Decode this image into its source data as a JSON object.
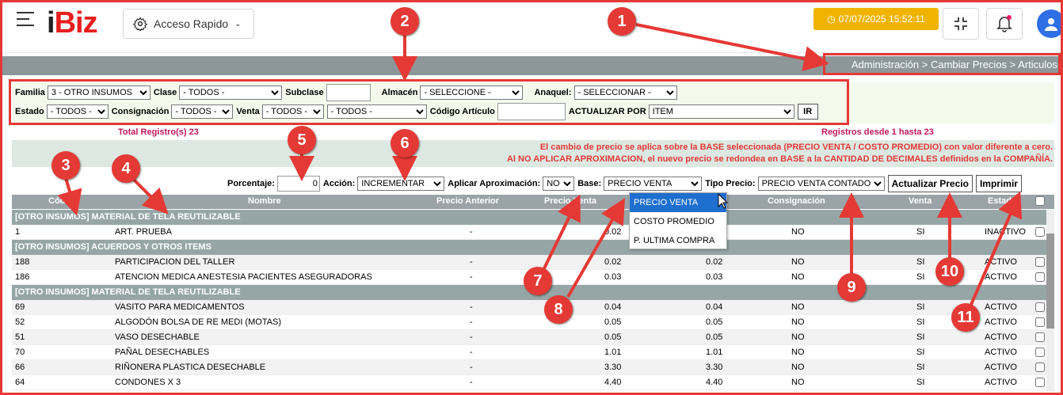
{
  "header": {
    "logo_i": "i",
    "logo_biz": "Biz",
    "quick_access": "Acceso Rapido",
    "datetime": "07/07/2025 15:52:11"
  },
  "breadcrumb": "Administración > Cambiar Precios > Articulos",
  "filters": {
    "familia_label": "Familia",
    "familia_value": "3 - OTRO INSUMOS",
    "clase_label": "Clase",
    "clase_value": "- TODOS -",
    "subclase_label": "Subclase",
    "subclase_value": "",
    "almacen_label": "Almacén",
    "almacen_value": "- SELECCIONE -",
    "anaquel_label": "Anaquel:",
    "anaquel_value": "- SELECCIONAR -",
    "estado_label": "Estado",
    "estado_value": "- TODOS -",
    "consignacion_label": "Consignación",
    "consignacion_value": "- TODOS -",
    "venta_label": "Venta",
    "venta_value": "- TODOS -",
    "venta_extra_value": "- TODOS -",
    "codigo_label": "Código Artículo",
    "codigo_value": "",
    "actualizar_label": "ACTUALIZAR POR",
    "actualizar_value": "ITEM",
    "ir_button": "IR"
  },
  "totals": {
    "total": "Total Registro(s) 23",
    "range": "Registros desde 1 hasta 23"
  },
  "notice": {
    "line1": "El cambio de precio se aplica sobre la BASE seleccionada (PRECIO VENTA / COSTO PROMEDIO) con valor diferente a cero.",
    "line2": "Al NO APLICAR APROXIMACION, el nuevo precio se redondea en BASE a la CANTIDAD DE DECIMALES definidos en la COMPAÑÍA."
  },
  "actions": {
    "porcentaje_label": "Porcentaje:",
    "porcentaje_value": "0",
    "accion_label": "Acción:",
    "accion_value": "INCREMENTAR",
    "aprox_label": "Aplicar Aproximación:",
    "aprox_value": "NO",
    "base_label": "Base:",
    "base_value": "PRECIO VENTA",
    "tipo_label": "Tipo Precio:",
    "tipo_value": "PRECIO VENTA CONTADO",
    "update_button": "Actualizar Precio",
    "print_button": "Imprimir"
  },
  "base_options": [
    "PRECIO VENTA",
    "COSTO PROMEDIO",
    "P. ULTIMA COMPRA"
  ],
  "table": {
    "headers": {
      "codigo": "Código",
      "nombre": "Nombre",
      "anterior": "Precio Anterior",
      "venta_precio": "Precio Venta",
      "consignacion": "Consignación",
      "venta": "Venta",
      "estado": "Estado"
    },
    "groups": [
      {
        "title": "[OTRO INSUMOS] MATERIAL DE TELA REUTILIZABLE",
        "rows": [
          {
            "code": "1",
            "name": "ART. PRUEBA",
            "prev": "-",
            "price": "0.02",
            "new": "",
            "cons": "NO",
            "venta": "SI",
            "estado": "INACTIVO"
          }
        ]
      },
      {
        "title": "[OTRO INSUMOS] ACUERDOS Y OTROS ITEMS",
        "rows": [
          {
            "code": "188",
            "name": "PARTICIPACION DEL TALLER",
            "prev": "-",
            "price": "0.02",
            "new": "0.02",
            "cons": "NO",
            "venta": "SI",
            "estado": "ACTIVO"
          },
          {
            "code": "186",
            "name": "ATENCION MEDICA ANESTESIA PACIENTES ASEGURADORAS",
            "prev": "-",
            "price": "0.03",
            "new": "0.03",
            "cons": "NO",
            "venta": "SI",
            "estado": "ACTIVO"
          }
        ]
      },
      {
        "title": "[OTRO INSUMOS] MATERIAL DE TELA REUTILIZABLE",
        "rows": [
          {
            "code": "69",
            "name": "VASITO PARA MEDICAMENTOS",
            "prev": "-",
            "price": "0.04",
            "new": "0.04",
            "cons": "NO",
            "venta": "SI",
            "estado": "ACTIVO"
          },
          {
            "code": "52",
            "name": "ALGODÓN BOLSA DE RE MEDI (MOTAS)",
            "prev": "-",
            "price": "0.05",
            "new": "0.05",
            "cons": "NO",
            "venta": "SI",
            "estado": "ACTIVO"
          },
          {
            "code": "51",
            "name": "VASO DESECHABLE",
            "prev": "-",
            "price": "0.05",
            "new": "0.05",
            "cons": "NO",
            "venta": "SI",
            "estado": "ACTIVO"
          },
          {
            "code": "70",
            "name": "PAÑAL DESECHABLES",
            "prev": "-",
            "price": "1.01",
            "new": "1.01",
            "cons": "NO",
            "venta": "SI",
            "estado": "ACTIVO"
          },
          {
            "code": "66",
            "name": "RIÑONERA PLASTICA DESECHABLE",
            "prev": "-",
            "price": "3.30",
            "new": "3.30",
            "cons": "NO",
            "venta": "SI",
            "estado": "ACTIVO"
          },
          {
            "code": "64",
            "name": "CONDONES X 3",
            "prev": "-",
            "price": "4.40",
            "new": "4.40",
            "cons": "NO",
            "venta": "SI",
            "estado": "ACTIVO"
          }
        ]
      }
    ]
  },
  "callouts": [
    "1",
    "2",
    "3",
    "4",
    "5",
    "6",
    "7",
    "8",
    "9",
    "10",
    "11"
  ],
  "colors": {
    "accent_red": "#e53935",
    "header_gray": "#8d979a",
    "date_badge": "#f0b400"
  }
}
